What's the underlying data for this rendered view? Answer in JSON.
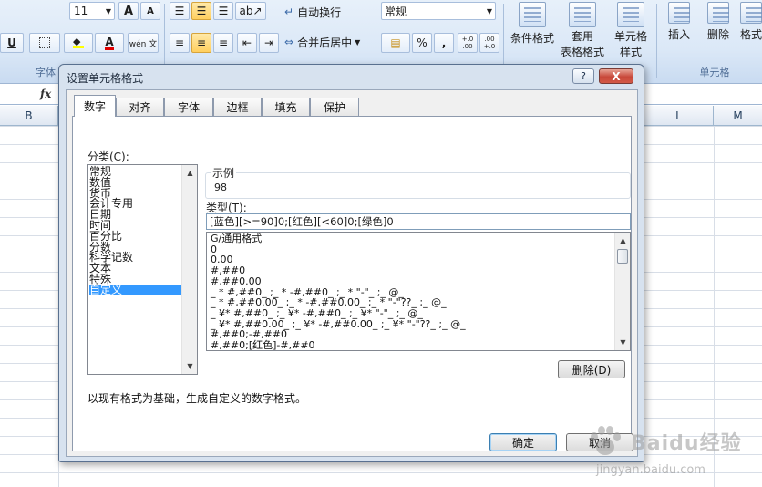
{
  "ribbon": {
    "font_size": "11",
    "font_grow": "A",
    "font_shrink": "A",
    "underline": "U",
    "font_color_glyph": "A",
    "phonetic_glyph": "wén 文",
    "wrap_text": "自动换行",
    "merge_center": "合并后居中",
    "number_format": "常规",
    "percent": "%",
    "comma": ",",
    "increase_decimal": "+.0 .00",
    "decrease_decimal": ".00 +.0",
    "conditional_format": "条件格式",
    "format_table_top": "套用",
    "format_table_bottom": "表格格式",
    "cell_style_top": "单元格",
    "cell_style_bottom": "样式",
    "insert": "插入",
    "delete": "删除",
    "format_partial": "格式",
    "group_font": "字体",
    "group_cells": "单元格"
  },
  "formula_bar": {
    "fx": "fx"
  },
  "columns": [
    "B",
    "L",
    "M"
  ],
  "dialog": {
    "title": "设置单元格格式",
    "help": "?",
    "close": "X",
    "tabs": [
      "数字",
      "对齐",
      "字体",
      "边框",
      "填充",
      "保护"
    ],
    "category_label": "分类(C):",
    "categories": [
      "常规",
      "数值",
      "货币",
      "会计专用",
      "日期",
      "时间",
      "百分比",
      "分数",
      "科学记数",
      "文本",
      "特殊",
      "自定义"
    ],
    "sample_label": "示例",
    "sample_value": "98",
    "type_label": "类型(T):",
    "type_value": "[蓝色][>=90]0;[红色][<60]0;[绿色]0",
    "formats": [
      "G/通用格式",
      "0",
      "0.00",
      "#,##0",
      "#,##0.00",
      "_ * #,##0_ ;_ * -#,##0_ ;_ * \"-\"_ ;_ @_",
      "_ * #,##0.00_ ;_ * -#,##0.00_ ;_ * \"-\"??_ ;_ @_",
      "_ ¥* #,##0_ ;_ ¥* -#,##0_ ;_ ¥* \"-\"_ ;_ @_",
      "_ ¥* #,##0.00_ ;_ ¥* -#,##0.00_ ;_ ¥* \"-\"??_ ;_ @_",
      "#,##0;-#,##0",
      "#,##0;[红色]-#,##0"
    ],
    "delete_button": "删除(D)",
    "description": "以现有格式为基础，生成自定义的数字格式。",
    "ok_button": "确定",
    "cancel_button": "取消"
  },
  "watermark": {
    "text": "Baidu经验",
    "url": "jingyan.baidu.com"
  }
}
